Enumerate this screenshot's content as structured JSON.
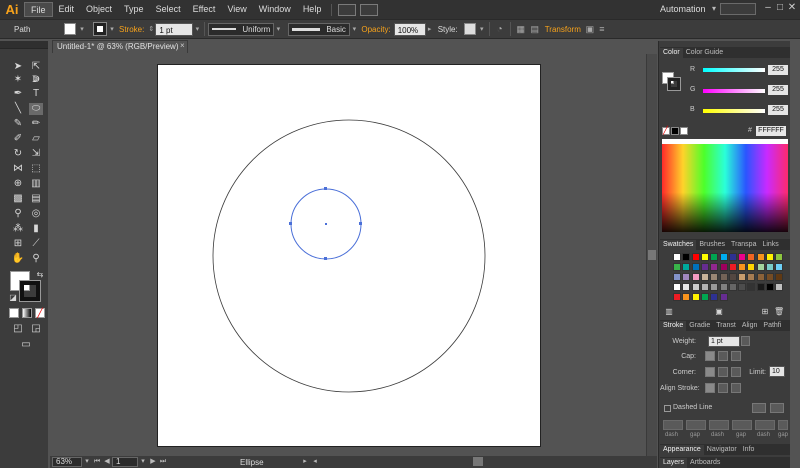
{
  "menubar": {
    "logo": "Ai",
    "items": [
      "File",
      "Edit",
      "Object",
      "Type",
      "Select",
      "Effect",
      "View",
      "Window",
      "Help"
    ],
    "workspace": "Automation",
    "window_controls": [
      "–",
      "□",
      "✕"
    ]
  },
  "controlbar": {
    "selection_label": "Path",
    "stroke_label": "Stroke:",
    "stroke_weight": "1 pt",
    "profile": "Uniform",
    "brush": "Basic",
    "opacity_label": "Opacity:",
    "opacity": "100%",
    "style_label": "Style:",
    "transform_label": "Transform"
  },
  "document": {
    "tab_title": "Untitled-1* @ 63% (RGB/Preview)",
    "close_glyph": "×"
  },
  "status": {
    "zoom": "63%",
    "artboard": "1",
    "tool_name": "Ellipse"
  },
  "color_panel": {
    "tabs": [
      "Color",
      "Color Guide"
    ],
    "channels": [
      {
        "label": "R",
        "value": "255",
        "color": "#ff0000"
      },
      {
        "label": "G",
        "value": "255",
        "color": "#00ff00"
      },
      {
        "label": "B",
        "value": "255",
        "color": "#0000ff"
      }
    ],
    "hex_symbol": "#",
    "hex": "FFFFFF"
  },
  "swatches_panel": {
    "tabs": [
      "Swatches",
      "Brushes",
      "Transpa",
      "Links"
    ],
    "rows": [
      [
        "#ffffff",
        "#000000",
        "#ff0000",
        "#ffff00",
        "#00a651",
        "#00aeef",
        "#2e3192",
        "#ec008c",
        "#f26522",
        "#f7941d",
        "#fff200",
        "#8dc63f"
      ],
      [
        "#39b54a",
        "#00a99d",
        "#0072bc",
        "#662d91",
        "#92278f",
        "#9e005d",
        "#ed1c24",
        "#f7941d",
        "#ffd500",
        "#a3d39c",
        "#7accc8",
        "#6dcff6"
      ],
      [
        "#8393ca",
        "#a186be",
        "#f49ac1",
        "#c7b299",
        "#998675",
        "#736357",
        "#534741",
        "#c69c6d",
        "#a67c52",
        "#8c6239",
        "#754c24",
        "#603913"
      ],
      [
        "#ffffff",
        "#e6e6e6",
        "#cccccc",
        "#b3b3b3",
        "#999999",
        "#808080",
        "#666666",
        "#4d4d4d",
        "#333333",
        "#1a1a1a",
        "#000000",
        "#c0c0c0"
      ],
      [
        "#ed1c24",
        "#f7941d",
        "#fff200",
        "#00a651",
        "#2e3192",
        "#662d91"
      ]
    ]
  },
  "stroke_panel": {
    "tabs": [
      "Stroke",
      "Gradie",
      "Transt",
      "Align",
      "Pathfi"
    ],
    "weight_label": "Weight:",
    "weight": "1 pt",
    "cap_label": "Cap:",
    "corner_label": "Corner:",
    "limit_label": "Limit:",
    "limit": "10",
    "align_label": "Align Stroke:",
    "dashed_label": "Dashed Line",
    "dash_labels": [
      "dash",
      "gap",
      "dash",
      "gap",
      "dash",
      "gap"
    ]
  },
  "appearance_panel": {
    "tabs": [
      "Appearance",
      "Navigator",
      "Info"
    ]
  },
  "layers_panel": {
    "tabs": [
      "Layers",
      "Artboards"
    ]
  },
  "colors": {
    "accent": "#f7a21b",
    "selection": "#4a6fd8"
  }
}
